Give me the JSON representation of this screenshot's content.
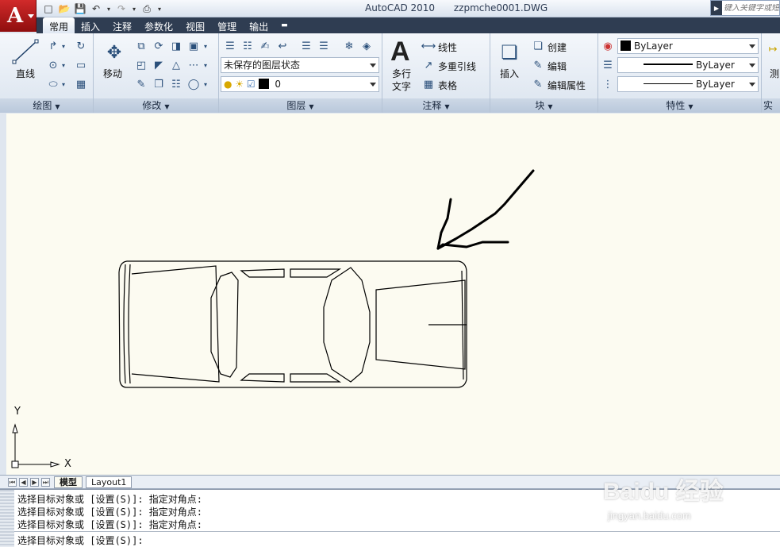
{
  "window": {
    "app_name": "AutoCAD 2010",
    "file_name": "zzpmche0001.DWG",
    "search_placeholder": "键入关键字或短语"
  },
  "quick_access": [
    "new-icon",
    "open-icon",
    "save-icon",
    "undo-icon",
    "redo-icon",
    "plot-icon"
  ],
  "tabs": [
    {
      "label": "常用",
      "active": true
    },
    {
      "label": "插入"
    },
    {
      "label": "注释"
    },
    {
      "label": "参数化"
    },
    {
      "label": "视图"
    },
    {
      "label": "管理"
    },
    {
      "label": "输出"
    }
  ],
  "ribbon": {
    "draw": {
      "title": "绘图",
      "line_label": "直线"
    },
    "modify": {
      "title": "修改",
      "move_label": "移动"
    },
    "layers": {
      "title": "图层",
      "layer_state": "未保存的图层状态",
      "current_layer": "0"
    },
    "annotation": {
      "title": "注释",
      "mtext_label_1": "多行",
      "mtext_label_2": "文字",
      "linear_label": "线性",
      "mleader_label": "多重引线",
      "table_label": "表格"
    },
    "block": {
      "title": "块",
      "insert_label": "插入",
      "create_label": "创建",
      "edit_label": "编辑",
      "edit_attr_label": "编辑属性"
    },
    "properties": {
      "title": "特性",
      "color": "ByLayer",
      "linetype": "ByLayer",
      "lineweight": "ByLayer"
    },
    "utilities": {
      "title": "实用",
      "measure_label": "测"
    }
  },
  "drawing": {
    "background": "#fcfbf1",
    "ucs_x_label": "X",
    "ucs_y_label": "Y"
  },
  "layout_tabs": [
    {
      "label": "模型",
      "active": true
    },
    {
      "label": "Layout1"
    }
  ],
  "command_history": [
    "选择目标对象或 [设置(S)]: 指定对角点:",
    "选择目标对象或 [设置(S)]: 指定对角点:",
    "选择目标对象或 [设置(S)]: 指定对角点:"
  ],
  "command_prompt": "选择目标对象或 [设置(S)]:",
  "watermark": {
    "brand": "Baidu 经验",
    "site": "jingyan.baidu.com"
  }
}
